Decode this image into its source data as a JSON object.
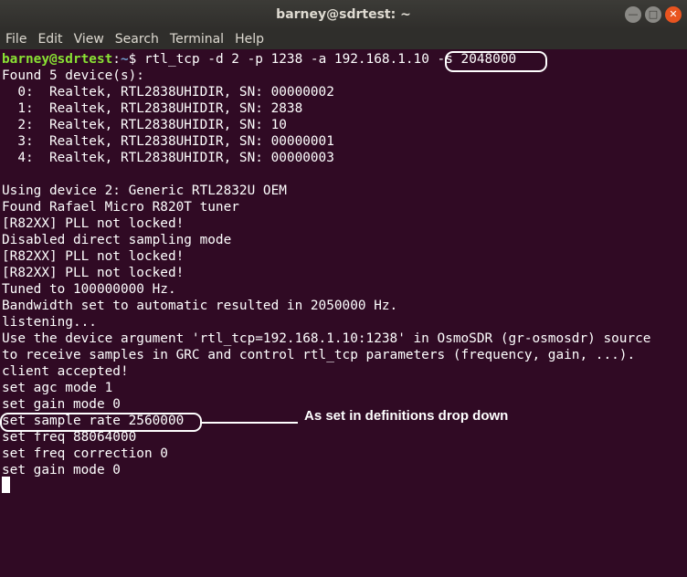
{
  "window": {
    "title": "barney@sdrtest: ~"
  },
  "menu": [
    "File",
    "Edit",
    "View",
    "Search",
    "Terminal",
    "Help"
  ],
  "prompt": {
    "userhost": "barney@sdrtest",
    "path": "~",
    "symbol": "$ ",
    "command": "rtl_tcp -d 2 -p 1238 -a 192.168.1.10 -s 2048000"
  },
  "lines": [
    "Found 5 device(s):",
    "  0:  Realtek, RTL2838UHIDIR, SN: 00000002",
    "  1:  Realtek, RTL2838UHIDIR, SN: 2838",
    "  2:  Realtek, RTL2838UHIDIR, SN: 10",
    "  3:  Realtek, RTL2838UHIDIR, SN: 00000001",
    "  4:  Realtek, RTL2838UHIDIR, SN: 00000003",
    "",
    "Using device 2: Generic RTL2832U OEM",
    "Found Rafael Micro R820T tuner",
    "[R82XX] PLL not locked!",
    "Disabled direct sampling mode",
    "[R82XX] PLL not locked!",
    "[R82XX] PLL not locked!",
    "Tuned to 100000000 Hz.",
    "Bandwidth set to automatic resulted in 2050000 Hz.",
    "listening...",
    "Use the device argument 'rtl_tcp=192.168.1.10:1238' in OsmoSDR (gr-osmosdr) source",
    "to receive samples in GRC and control rtl_tcp parameters (frequency, gain, ...).",
    "client accepted!",
    "set agc mode 1",
    "set gain mode 0",
    "set sample rate 2560000",
    "set freq 88064000",
    "set freq correction 0",
    "set gain mode 0"
  ],
  "annotation": {
    "text": "As set in definitions drop down"
  }
}
